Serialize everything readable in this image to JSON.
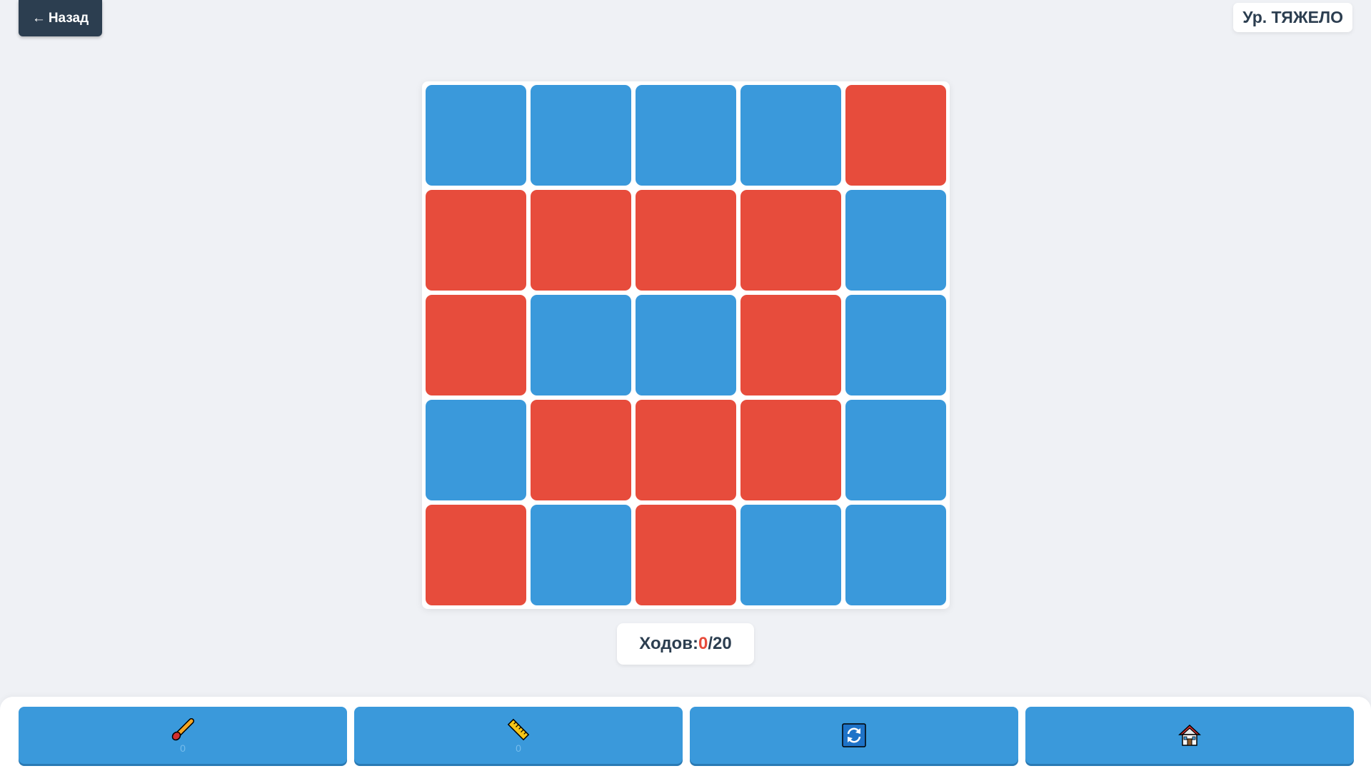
{
  "header": {
    "back_arrow": "←",
    "back_label": "Назад",
    "level_label": "Ур. ТЯЖЕЛО"
  },
  "colors": {
    "blue": "#3a99db",
    "red": "#e74c3c",
    "dark": "#2c3e50"
  },
  "board": {
    "rows": 5,
    "cols": 5,
    "cells": [
      [
        "blue",
        "blue",
        "blue",
        "blue",
        "red"
      ],
      [
        "red",
        "red",
        "red",
        "red",
        "blue"
      ],
      [
        "red",
        "blue",
        "blue",
        "red",
        "blue"
      ],
      [
        "blue",
        "red",
        "red",
        "red",
        "blue"
      ],
      [
        "red",
        "blue",
        "red",
        "blue",
        "blue"
      ]
    ]
  },
  "moves": {
    "label": "Ходов:",
    "current": "0",
    "separator": "/",
    "max": "20"
  },
  "toolbar": {
    "tools": [
      {
        "icon": "paintbrush-icon",
        "count": "0"
      },
      {
        "icon": "ruler-icon",
        "count": "0"
      },
      {
        "icon": "refresh-icon"
      },
      {
        "icon": "home-icon"
      }
    ]
  }
}
